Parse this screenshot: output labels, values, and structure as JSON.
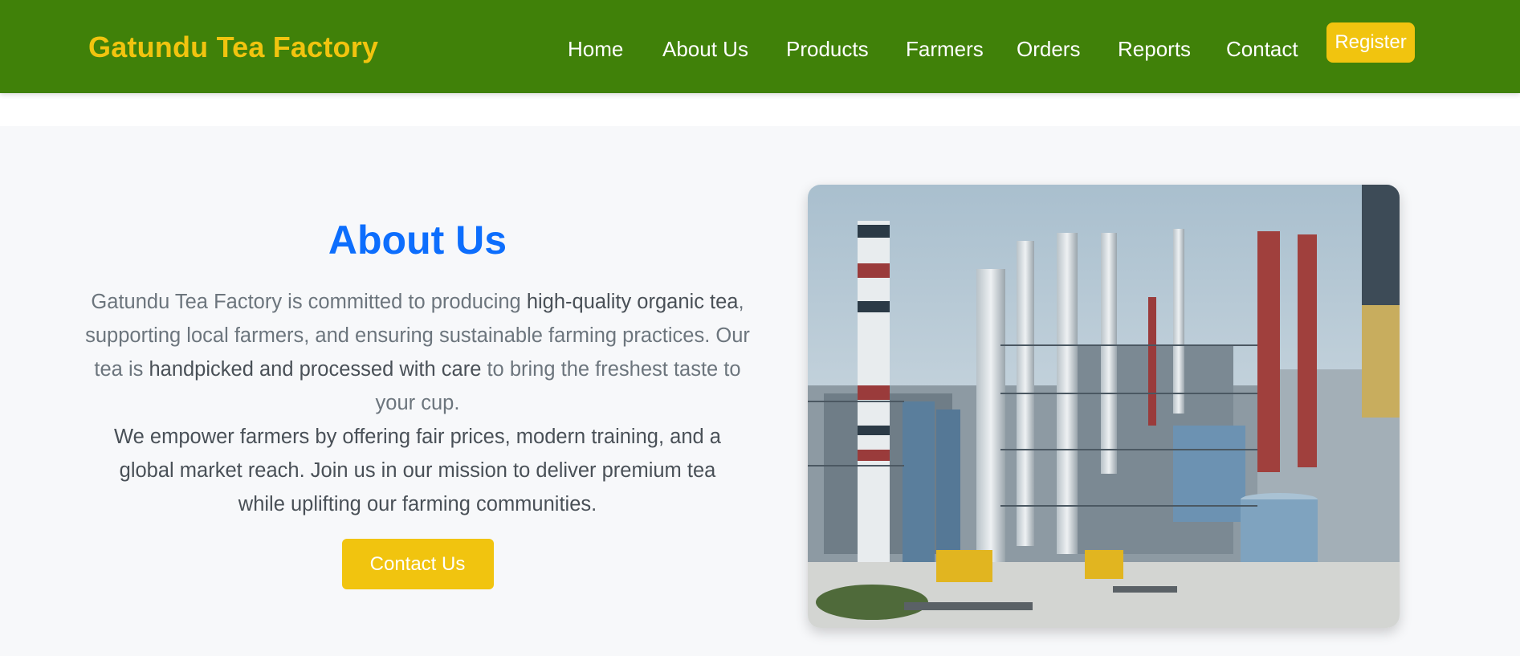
{
  "header": {
    "brand": "Gatundu Tea Factory",
    "nav": [
      "Home",
      "About Us",
      "Products",
      "Farmers",
      "Orders",
      "Reports",
      "Contact"
    ],
    "register_label": "Register"
  },
  "about": {
    "title": "About Us",
    "para1": {
      "part1": "Gatundu Tea Factory is committed to producing ",
      "bold1": "high-quality organic tea",
      "part2": ", supporting local farmers, and ensuring sustainable farming practices. Our tea is ",
      "bold2": "handpicked and processed with care",
      "part3": " to bring the freshest taste to your cup."
    },
    "para2": "We empower farmers by offering fair prices, modern training, and a global market reach. Join us in our mission to deliver premium tea while uplifting our farming communities.",
    "contact_label": "Contact Us"
  },
  "colors": {
    "navbar": "#408109",
    "accent_yellow": "#f1c40f",
    "title_blue": "#0d6efd",
    "section_bg": "#f7f8fa"
  }
}
